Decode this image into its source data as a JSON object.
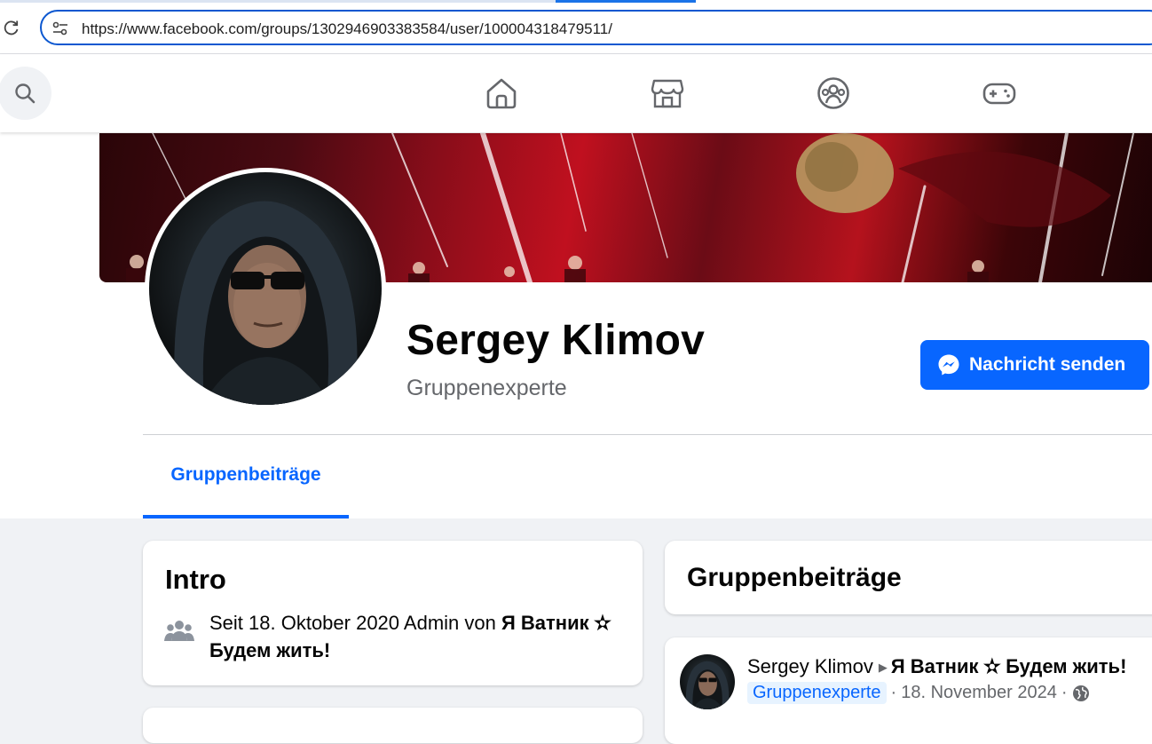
{
  "browser": {
    "url": "https://www.facebook.com/groups/1302946903383584/user/100004318479511/"
  },
  "nav": {
    "items": [
      "home-icon",
      "marketplace-icon",
      "groups-icon",
      "gaming-icon"
    ]
  },
  "profile": {
    "name": "Sergey Klimov",
    "role": "Gruppenexperte",
    "message_button": "Nachricht senden"
  },
  "tabs": {
    "active": "Gruppenbeiträge"
  },
  "intro": {
    "title": "Intro",
    "text_prefix": "Seit 18. Oktober 2020 Admin von ",
    "group_name": "Я Ватник ✫ Будем жить!"
  },
  "posts": {
    "title": "Gruppenbeiträge",
    "first": {
      "author": "Sergey Klimov",
      "group": "Я Ватник ✫ Будем жить!",
      "badge": "Gruppenexperte",
      "date": "18. November 2024",
      "sep": "·"
    }
  },
  "colors": {
    "accent": "#0866ff",
    "url_border": "#0b57d0",
    "page_bg": "#f0f2f5"
  }
}
